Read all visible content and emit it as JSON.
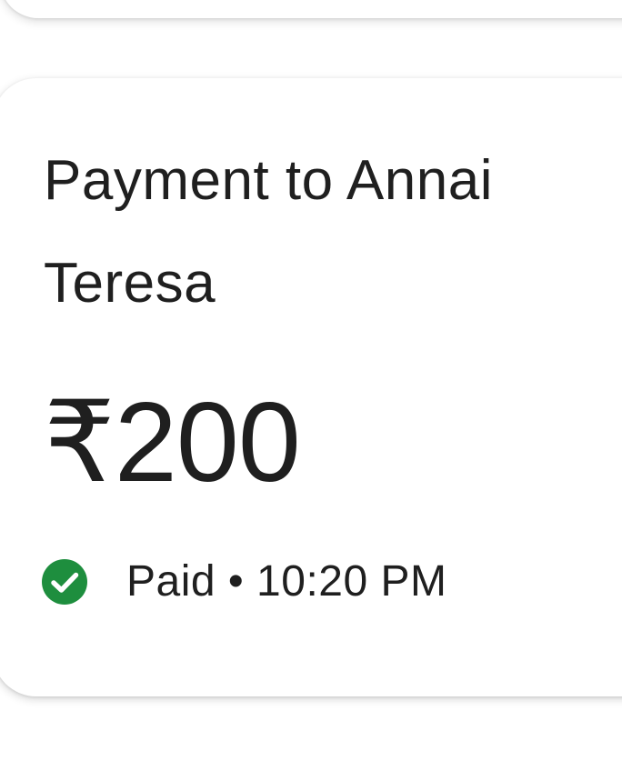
{
  "transaction": {
    "title": "Payment to Annai Teresa",
    "amount": "₹200",
    "status": {
      "icon": "check-circle-icon",
      "icon_color": "#1e8e3e",
      "text": "Paid • 10:20 PM"
    }
  }
}
